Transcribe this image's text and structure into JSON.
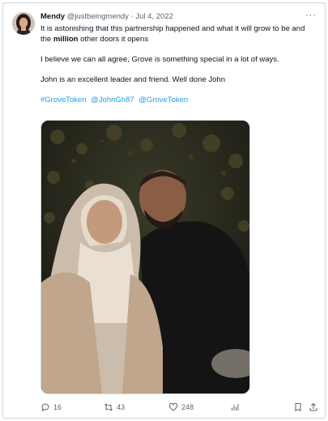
{
  "tweet": {
    "author_name": "Mendy",
    "handle": "@justbeingmendy",
    "separator": "·",
    "date": "Jul 4, 2022",
    "more_label": "···",
    "line1_start": "It is astonishing that this partnership happened and what it will grow to be and the ",
    "line1_bold": "million",
    "line1_end": " other doors it opens",
    "paragraph2": "I believe we can all agree, Grove is something special in a lot of ways.",
    "paragraph3": "John is an excellent leader and friend. Well done John",
    "tags": [
      "#GroveToken",
      "@JohnGh87",
      "@GroveToken"
    ]
  },
  "actions": {
    "replies": "16",
    "retweets": "43",
    "likes": "248"
  },
  "colors": {
    "link": "#1d9bf0",
    "muted": "#536471",
    "border": "#cfd9de",
    "text": "#0f1419"
  },
  "icons": {
    "reply": "reply-icon",
    "retweet": "retweet-icon",
    "like": "heart-icon",
    "views": "analytics-icon",
    "bookmark": "bookmark-icon",
    "share": "share-icon"
  }
}
